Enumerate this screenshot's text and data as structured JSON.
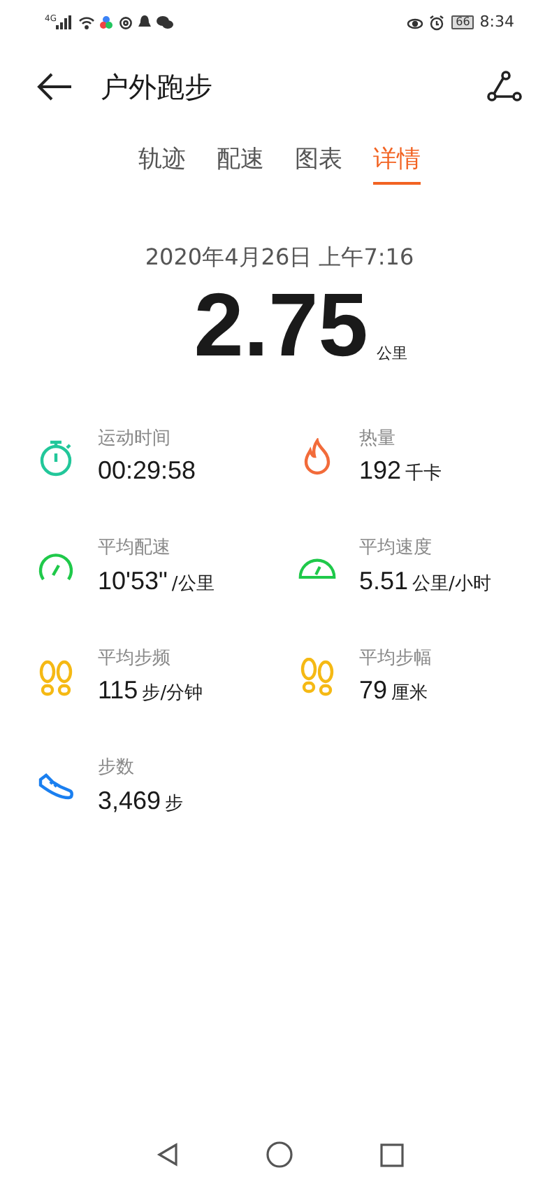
{
  "status_bar": {
    "network": "4G",
    "battery": "66",
    "time": "8:34"
  },
  "header": {
    "title": "户外跑步"
  },
  "tabs": [
    {
      "label": "轨迹",
      "selected": false
    },
    {
      "label": "配速",
      "selected": false
    },
    {
      "label": "图表",
      "selected": false
    },
    {
      "label": "详情",
      "selected": true
    }
  ],
  "summary": {
    "datetime": "2020年4月26日 上午7:16",
    "distance": "2.75",
    "unit": "公里"
  },
  "stats": [
    {
      "kind": "timer",
      "label": "运动时间",
      "value": "00:29:58"
    },
    {
      "kind": "calories",
      "label": "热量",
      "value": "192",
      "unit": "千卡"
    },
    {
      "kind": "pace",
      "label": "平均配速",
      "value": "10'53\"",
      "unit": "/公里"
    },
    {
      "kind": "speed",
      "label": "平均速度",
      "value": "5.51",
      "unit": "公里/小时"
    },
    {
      "kind": "cadence",
      "label": "平均步频",
      "value": "115",
      "unit": "步/分钟"
    },
    {
      "kind": "stride",
      "label": "平均步幅",
      "value": "79",
      "unit": "厘米"
    },
    {
      "kind": "steps",
      "label": "步数",
      "value": "3,469",
      "unit": "步"
    }
  ]
}
